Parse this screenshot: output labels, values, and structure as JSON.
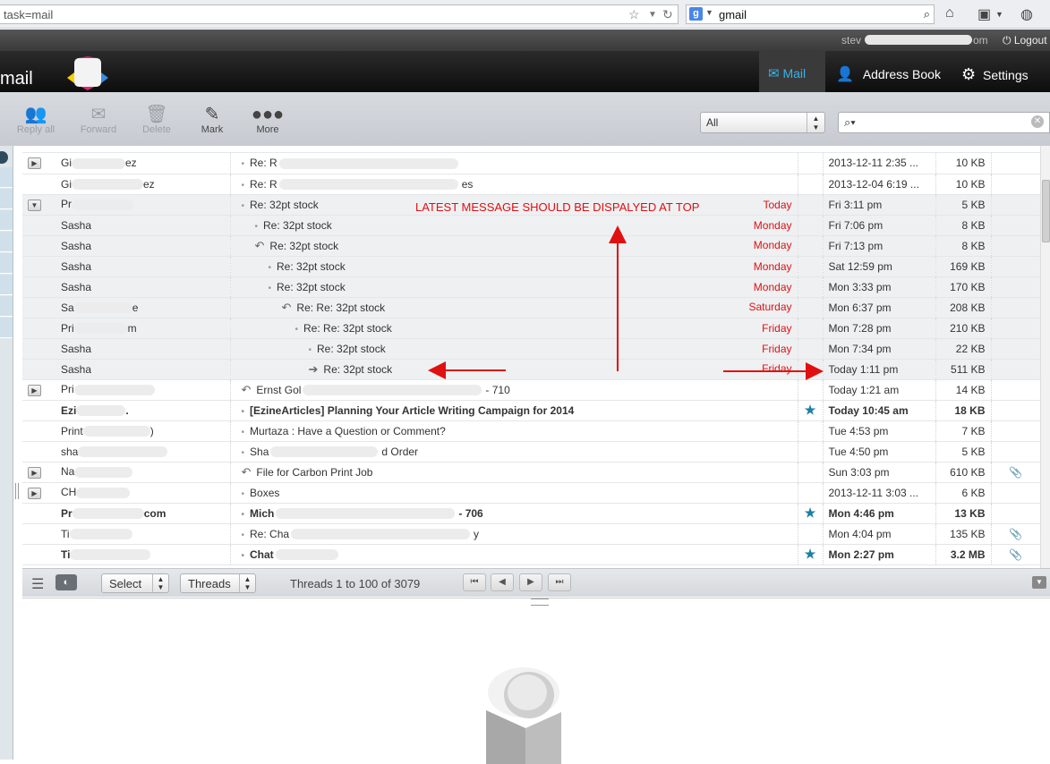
{
  "browser": {
    "url": "task=mail",
    "search_value": "gmail",
    "search_engine_badge": "g"
  },
  "user": {
    "email_prefix": "stev",
    "email_suffix": "om",
    "logout_label": "Logout"
  },
  "header": {
    "app_title": "mail",
    "nav": [
      {
        "label": "Mail",
        "icon": "envelope-icon"
      },
      {
        "label": "Address Book",
        "icon": "person-icon"
      },
      {
        "label": "Settings",
        "icon": "gear-icon"
      }
    ]
  },
  "toolbar": {
    "buttons": [
      {
        "label": "Reply all",
        "icon": "reply-all-icon"
      },
      {
        "label": "Forward",
        "icon": "forward-icon"
      },
      {
        "label": "Delete",
        "icon": "trash-icon"
      },
      {
        "label": "Mark",
        "icon": "pen-icon"
      },
      {
        "label": "More",
        "icon": "dots-icon"
      }
    ],
    "filter_value": "All",
    "search_placeholder": ""
  },
  "annotation": {
    "text": "LATEST MESSAGE SHOULD BE DISPALYED AT TOP",
    "color": "#e01010"
  },
  "messages": [
    {
      "toggle": "▶",
      "from": "Gi",
      "from_tail": "ez",
      "subject": "Re: R",
      "subject_tail": "",
      "date": "2013-12-11 2:35 ...",
      "size": "10 KB",
      "type": "normal",
      "indent": 0,
      "icon": "dot"
    },
    {
      "toggle": "",
      "from": "Gi",
      "from_tail": "ez",
      "subject": "Re: R",
      "subject_tail": "es",
      "date": "2013-12-04 6:19 ...",
      "size": "10 KB",
      "type": "normal",
      "indent": 0,
      "icon": "dot"
    },
    {
      "toggle": "▼",
      "from": "Pr",
      "from_tail": "",
      "subject": "Re: 32pt stock",
      "subject_tail": "",
      "note": "Today",
      "date": "Fri 3:11 pm",
      "size": "5 KB",
      "type": "thread",
      "indent": 0,
      "icon": "dot"
    },
    {
      "toggle": "",
      "from": "Sasha",
      "from_tail": "",
      "subject": "Re: 32pt stock",
      "subject_tail": "",
      "note": "Monday",
      "date": "Fri 7:06 pm",
      "size": "8 KB",
      "type": "thread",
      "indent": 1,
      "icon": "dot"
    },
    {
      "toggle": "",
      "from": "Sasha",
      "from_tail": "",
      "subject": "Re: 32pt stock",
      "subject_tail": "",
      "note": "Monday",
      "date": "Fri 7:13 pm",
      "size": "8 KB",
      "type": "thread",
      "indent": 1,
      "icon": "reply"
    },
    {
      "toggle": "",
      "from": "Sasha",
      "from_tail": "",
      "subject": "Re: 32pt stock",
      "subject_tail": "",
      "note": "Monday",
      "date": "Sat 12:59 pm",
      "size": "169 KB",
      "type": "thread",
      "indent": 2,
      "icon": "dot"
    },
    {
      "toggle": "",
      "from": "Sasha",
      "from_tail": "",
      "subject": "Re: 32pt stock",
      "subject_tail": "",
      "note": "Monday",
      "date": "Mon 3:33 pm",
      "size": "170 KB",
      "type": "thread",
      "indent": 2,
      "icon": "dot"
    },
    {
      "toggle": "",
      "from": "Sa",
      "from_tail": "e",
      "subject": "Re: Re: 32pt stock",
      "subject_tail": "",
      "note": "Saturday",
      "date": "Mon 6:37 pm",
      "size": "208 KB",
      "type": "thread",
      "indent": 3,
      "icon": "reply"
    },
    {
      "toggle": "",
      "from": "Pri",
      "from_tail": "m",
      "subject": "Re: Re: 32pt stock",
      "subject_tail": "",
      "note": "Friday",
      "date": "Mon 7:28 pm",
      "size": "210 KB",
      "type": "thread",
      "indent": 4,
      "icon": "dot"
    },
    {
      "toggle": "",
      "from": "Sasha",
      "from_tail": "",
      "subject": "Re: 32pt stock",
      "subject_tail": "",
      "note": "Friday",
      "date": "Mon 7:34 pm",
      "size": "22 KB",
      "type": "thread",
      "indent": 5,
      "icon": "dot"
    },
    {
      "toggle": "",
      "from": "Sasha",
      "from_tail": "",
      "subject": "Re: 32pt stock",
      "subject_tail": "",
      "note": "Friday",
      "date": "Today 1:11 pm",
      "size": "511 KB",
      "type": "thread",
      "indent": 5,
      "icon": "forward"
    },
    {
      "toggle": "▶",
      "from": "Pri",
      "from_tail": "",
      "subject": "Ernst Gol",
      "subject_tail": "- 710",
      "date": "Today 1:21 am",
      "size": "14 KB",
      "type": "normal",
      "indent": 0,
      "icon": "reply"
    },
    {
      "toggle": "",
      "from": "Ezi",
      "from_tail": ".",
      "subject": "[EzineArticles] Planning Your Article Writing Campaign for 2014",
      "subject_tail": "",
      "date": "Today 10:45 am",
      "size": "18 KB",
      "type": "bold",
      "indent": 0,
      "icon": "dot",
      "flag": "★"
    },
    {
      "toggle": "",
      "from": "Print",
      "from_tail": ")",
      "subject": "Murtaza : Have a Question or Comment?",
      "subject_tail": "",
      "date": "Tue 4:53 pm",
      "size": "7 KB",
      "type": "normal",
      "indent": 0,
      "icon": "dot"
    },
    {
      "toggle": "",
      "from": "sha",
      "from_tail": "",
      "subject": "Sha",
      "subject_tail": "d Order",
      "date": "Tue 4:50 pm",
      "size": "5 KB",
      "type": "normal",
      "indent": 0,
      "icon": "dot"
    },
    {
      "toggle": "▶",
      "from": "Na",
      "from_tail": "",
      "subject": "File for Carbon Print Job",
      "subject_tail": "",
      "date": "Sun 3:03 pm",
      "size": "610 KB",
      "type": "normal",
      "indent": 0,
      "icon": "reply",
      "attach": true
    },
    {
      "toggle": "▶",
      "from": "CH",
      "from_tail": "",
      "subject": "Boxes",
      "subject_tail": "",
      "date": "2013-12-11 3:03 ...",
      "size": "6 KB",
      "type": "normal",
      "indent": 0,
      "icon": "dot"
    },
    {
      "toggle": "",
      "from": "Pr",
      "from_tail": "com",
      "subject": "Mich",
      "subject_tail": "- 706",
      "date": "Mon 4:46 pm",
      "size": "13 KB",
      "type": "bold",
      "indent": 0,
      "icon": "dot",
      "flag": "★"
    },
    {
      "toggle": "",
      "from": "Ti",
      "from_tail": "",
      "subject": "Re: Cha",
      "subject_tail": "y",
      "date": "Mon 4:04 pm",
      "size": "135 KB",
      "type": "normal",
      "indent": 0,
      "icon": "dot",
      "attach": true
    },
    {
      "toggle": "",
      "from": "Ti",
      "from_tail": "",
      "subject": "Chat",
      "subject_tail": "",
      "date": "Mon 2:27 pm",
      "size": "3.2 MB",
      "type": "bold",
      "indent": 0,
      "icon": "dot",
      "flag": "★",
      "attach": true
    }
  ],
  "footer": {
    "select_label": "Select",
    "threads_label": "Threads",
    "thread_count": "Threads 1 to 100 of 3079"
  }
}
